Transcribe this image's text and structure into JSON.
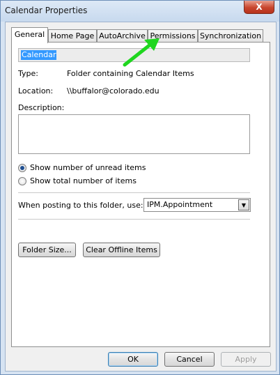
{
  "window": {
    "title": "Calendar Properties",
    "close_glyph": "X"
  },
  "tabs": [
    {
      "label": "General",
      "active": true
    },
    {
      "label": "Home Page",
      "active": false
    },
    {
      "label": "AutoArchive",
      "active": false
    },
    {
      "label": "Permissions",
      "active": false
    },
    {
      "label": "Synchronization",
      "active": false
    }
  ],
  "general": {
    "name_value": "Calendar",
    "type_label": "Type:",
    "type_value": "Folder containing Calendar Items",
    "location_label": "Location:",
    "location_value": "\\\\buffalor@colorado.edu",
    "description_label": "Description:",
    "description_value": "",
    "radio_unread": "Show number of unread items",
    "radio_total": "Show total number of items",
    "posting_label": "When posting to this folder, use:",
    "posting_value": "IPM.Appointment",
    "folder_size_button": "Folder Size...",
    "clear_offline_button": "Clear Offline Items"
  },
  "footer": {
    "ok": "OK",
    "cancel": "Cancel",
    "apply": "Apply"
  },
  "annotation": {
    "arrow_color": "#1fd61f"
  }
}
